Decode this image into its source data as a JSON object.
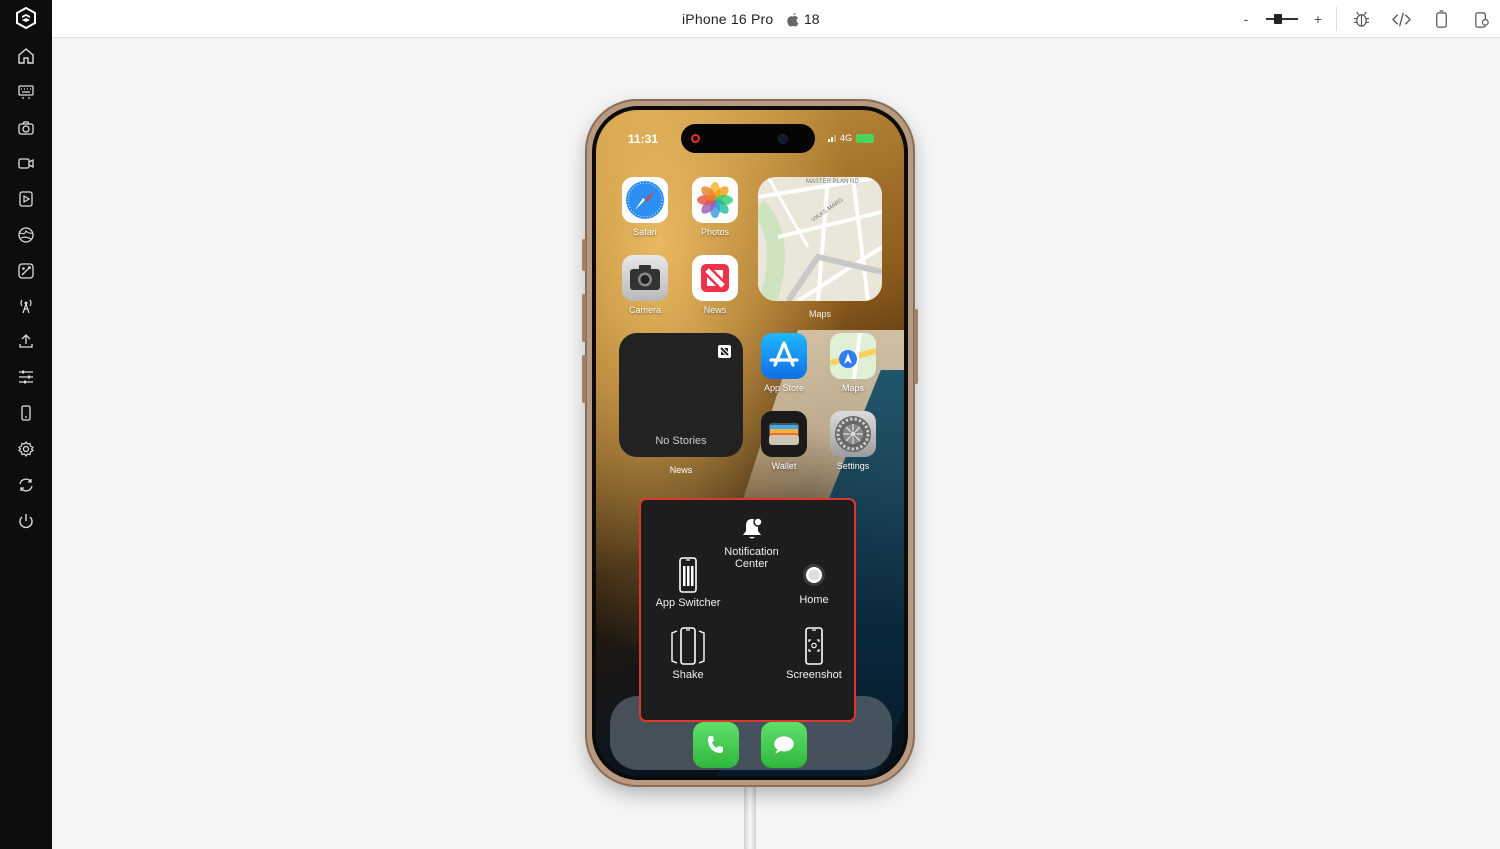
{
  "topbar": {
    "device_name": "iPhone 16 Pro",
    "os_version": "18",
    "zoom_out_label": "-",
    "zoom_in_label": "+",
    "zoom_level": 0.35
  },
  "sidebar": {
    "items": [
      {
        "icon": "home-icon"
      },
      {
        "icon": "keyboard-icon"
      },
      {
        "icon": "camera-icon"
      },
      {
        "icon": "video-icon"
      },
      {
        "icon": "media-play-icon"
      },
      {
        "icon": "globe-icon"
      },
      {
        "icon": "image-edit-icon"
      },
      {
        "icon": "antenna-icon"
      },
      {
        "icon": "upload-icon"
      },
      {
        "icon": "sliders-icon"
      },
      {
        "icon": "device-icon"
      },
      {
        "icon": "gear-icon"
      },
      {
        "icon": "sync-icon"
      },
      {
        "icon": "power-icon"
      }
    ]
  },
  "phone": {
    "status": {
      "time": "11:31",
      "network": "4G"
    },
    "apps": {
      "safari": "Safari",
      "photos": "Photos",
      "camera": "Camera",
      "news": "News",
      "appstore": "App Store",
      "maps": "Maps",
      "wallet": "Wallet",
      "settings": "Settings"
    },
    "maps_widget": {
      "label": "Maps",
      "street1": "MASTER PLAN RD",
      "street2": "VIKAS MARG"
    },
    "news_widget": {
      "text": "No Stories",
      "label": "News"
    }
  },
  "assistive_menu": {
    "notification_center": "Notification\nCenter",
    "app_switcher": "App Switcher",
    "home": "Home",
    "shake": "Shake",
    "screenshot": "Screenshot"
  },
  "colors": {
    "sidebar_bg": "#0d0d0d",
    "highlight_border": "#e0362b",
    "page_bg": "#f5f5f5"
  }
}
